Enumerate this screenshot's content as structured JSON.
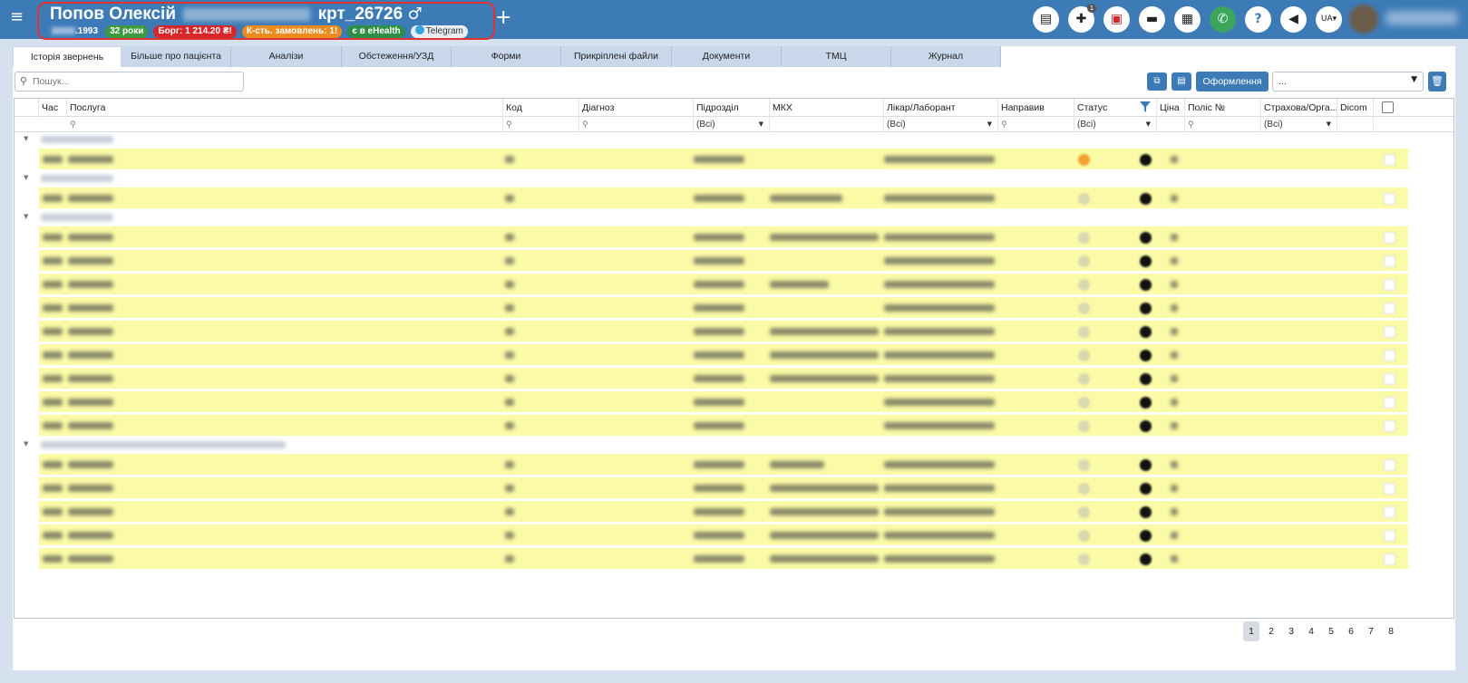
{
  "header": {
    "patient_name": "Попов Олексій",
    "card_number": "крт_26726",
    "gender_symbol": "♂",
    "dob_suffix": ".1993",
    "age": "32 роки",
    "debt": "Борг: 1 214.20 ₴!",
    "orders": "К-сть. замовлень: 1!",
    "ehealth": "є в eHealth",
    "telegram": "Telegram",
    "add_symbol": "+",
    "menu_symbol": "≡",
    "notification_count": "1",
    "language": "UA"
  },
  "tabs": [
    "Історія звернень",
    "Більше про пацієнта",
    "Аналізи",
    "Обстеження/УЗД",
    "Форми",
    "Прикріплені файли",
    "Документи",
    "ТМЦ",
    "Журнал"
  ],
  "toolbar": {
    "search_placeholder": "Пошук...",
    "oform_label": "Оформлення",
    "select_value": "..."
  },
  "grid": {
    "columns": [
      "Час",
      "Послуга",
      "Код",
      "Діагноз",
      "Підрозділ",
      "МКХ",
      "Лікар/Лаборант",
      "Направив",
      "Статус",
      "Ціна",
      "Поліс №",
      "Страхова/Орга...",
      "Dicom"
    ],
    "filters": {
      "division": "(Всі)",
      "doctor": "(Всі)",
      "status": "(Всі)",
      "insurance": "(Всі)"
    }
  },
  "pagination": [
    "1",
    "2",
    "3",
    "4",
    "5",
    "6",
    "7",
    "8"
  ],
  "pagination_active": "1",
  "colors": {
    "header_bg": "#3d7bb7",
    "row_highlight": "#fbfaa6",
    "debt_badge": "#d8262b",
    "orders_badge": "#ec8b1d",
    "age_badge": "#3e9a3e"
  }
}
